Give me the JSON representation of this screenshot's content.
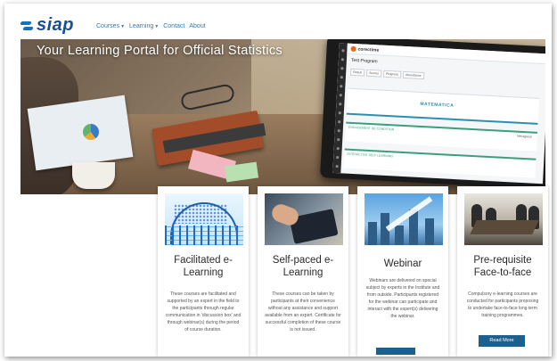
{
  "header": {
    "logo_text": "siap",
    "nav": [
      {
        "label": "Courses",
        "has_dropdown": true
      },
      {
        "label": "Learning",
        "has_dropdown": true
      },
      {
        "label": "Contact",
        "has_dropdown": false
      },
      {
        "label": "About",
        "has_dropdown": false
      }
    ]
  },
  "hero": {
    "title": "Your Learning Portal for Official Statistics",
    "tablet": {
      "brand": "corectime",
      "page_title": "Test Program",
      "tabs": [
        "Result",
        "Scores",
        "Progress",
        "Attendance"
      ],
      "band_title": "MATEMATICA",
      "sections": [
        {
          "label": "ENGAGEMENT DE CONDITION",
          "meta": "Nenaglese"
        },
        {
          "label": "INTERACTIVE SELF LEARNING",
          "meta": ""
        }
      ]
    }
  },
  "cards": [
    {
      "title": "Facilitated e-Learning",
      "text": "These courses are facilitated and supported by an expert in the field to the participants through regular communication in 'discussion box' and through webinar(s) during the period of course duration.",
      "button": ""
    },
    {
      "title": "Self-paced e-Learning",
      "text": "These courses can be taken by participants at their convenience without any assistance and support available from an expert. Certificate for successful completion of these course is not issued.",
      "button": ""
    },
    {
      "title": "Webinar",
      "text": "Webinars are delivered on special subject by experts in the Institute and from outside. Participants registered for the webinar can participate and interact with the expert(s) delivering the webinar.",
      "button": ""
    },
    {
      "title": "Pre-requisite Face-to-face",
      "text": "Compulsory e-learning courses are conducted for participants proposing to undertake face-to-face long term training programmes.",
      "button": "Read More"
    }
  ],
  "colors": {
    "brand": "#1c4f8f",
    "nav": "#2a7cc0",
    "button": "#1d5f8d"
  }
}
